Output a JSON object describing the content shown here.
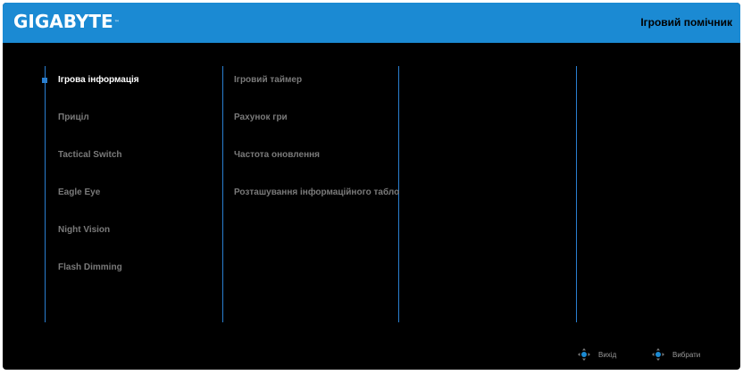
{
  "header": {
    "brand": "GIGABYTE",
    "brand_tm": "™",
    "title": "Ігровий помічник"
  },
  "menu": {
    "items": [
      {
        "label": "Ігрова інформація",
        "active": true
      },
      {
        "label": "Приціл"
      },
      {
        "label": "Tactical Switch"
      },
      {
        "label": "Eagle Eye"
      },
      {
        "label": "Night Vision"
      },
      {
        "label": "Flash Dimming"
      }
    ]
  },
  "submenu": {
    "items": [
      {
        "label": "Ігровий таймер"
      },
      {
        "label": "Рахунок гри"
      },
      {
        "label": "Частота оновлення"
      },
      {
        "label": "Розташування інформаційного табло"
      }
    ]
  },
  "footer": {
    "exit_label": "Вихід",
    "select_label": "Вибрати",
    "exit_icon": "joystick-icon",
    "select_icon": "joystick-icon"
  },
  "colors": {
    "header_bg": "#1b8ad3",
    "accent": "#2a7fd0",
    "background": "#000000",
    "inactive_text": "#7a7a7a",
    "active_text": "#ffffff"
  }
}
